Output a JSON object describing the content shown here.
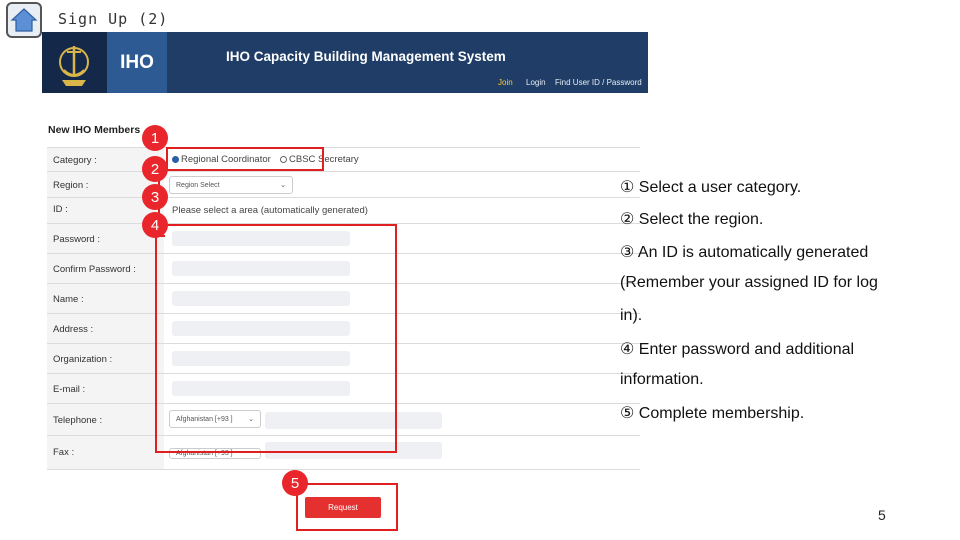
{
  "slide": {
    "title": "Sign Up (2)",
    "page_number": "5"
  },
  "site": {
    "logo_text": "IHO",
    "title": "IHO Capacity Building Management System",
    "nav": {
      "join": "Join",
      "login": "Login",
      "find": "Find User ID / Password"
    }
  },
  "form": {
    "heading": "New IHO Members",
    "labels": {
      "category": "Category :",
      "region": "Region :",
      "id": "ID :",
      "password": "Password :",
      "confirm": "Confirm Password :",
      "name": "Name :",
      "address": "Address :",
      "organization": "Organization :",
      "email": "E-mail :",
      "telephone": "Telephone :",
      "fax": "Fax :"
    },
    "category_options": [
      "Regional Coordinator",
      "CBSC Secretary"
    ],
    "region_select": "Region Select",
    "id_placeholder": "Please select a area (automatically generated)",
    "country_code": "Afghanistan [+93 ]",
    "country_code_fax": "Afghanistan [+93 ]",
    "request_label": "Request"
  },
  "badges": [
    "1",
    "2",
    "3",
    "4",
    "5"
  ],
  "instructions": [
    "① Select a user category.",
    "② Select the region.",
    "③ An ID is automatically generated",
    "(Remember your assigned ID for log",
    "in).",
    "④ Enter password and additional",
    "information.",
    "⑤ Complete membership."
  ]
}
